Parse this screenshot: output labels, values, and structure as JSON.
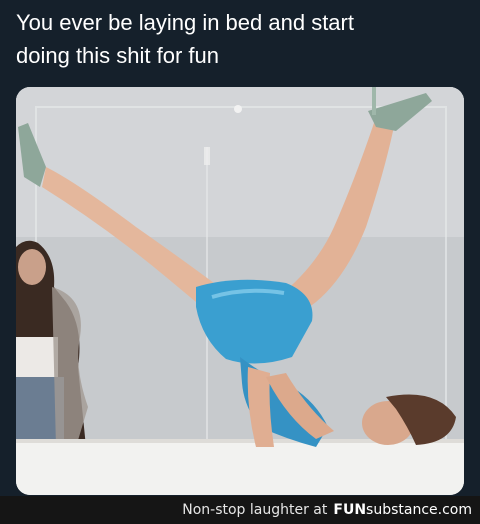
{
  "caption": {
    "line1": "You ever be laying in bed and start",
    "line2": "doing this shit for fun"
  },
  "photo": {
    "description_icon": "photo-image"
  },
  "footer": {
    "tagline": "Non-stop laughter at",
    "brand_bold": "FUN",
    "brand_rest": "substance.com"
  },
  "colors": {
    "background": "#15202b",
    "footer_bg": "#151515",
    "dress": "#3a9fd0"
  }
}
